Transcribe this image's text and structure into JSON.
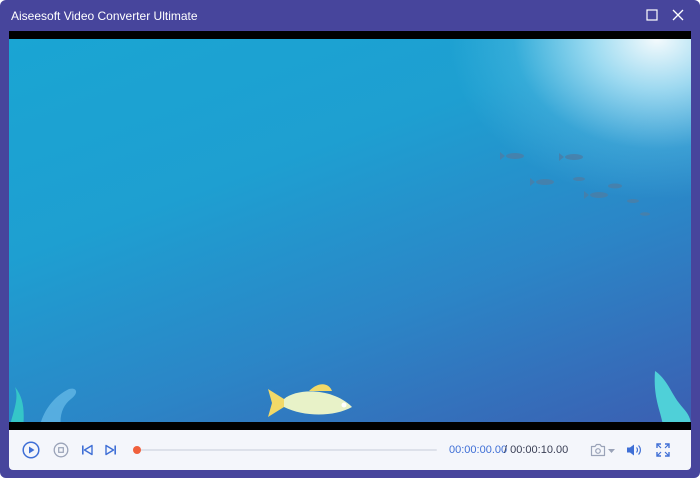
{
  "window": {
    "title": "Aiseesoft Video Converter Ultimate",
    "icons": {
      "maximize": "maximize-icon",
      "close": "close-icon"
    }
  },
  "player": {
    "progress": 0,
    "time_current": "00:00:00.00",
    "time_total": "/ 00:00:10.00",
    "icons": {
      "play": "play-icon",
      "stop": "stop-icon",
      "prev": "skip-previous-icon",
      "next": "skip-next-icon",
      "snapshot": "camera-icon",
      "volume": "volume-icon",
      "fullscreen": "fullscreen-icon"
    },
    "colors": {
      "accent": "#3f6fd6",
      "progress": "#f0603c",
      "frame": "#47459c"
    }
  }
}
